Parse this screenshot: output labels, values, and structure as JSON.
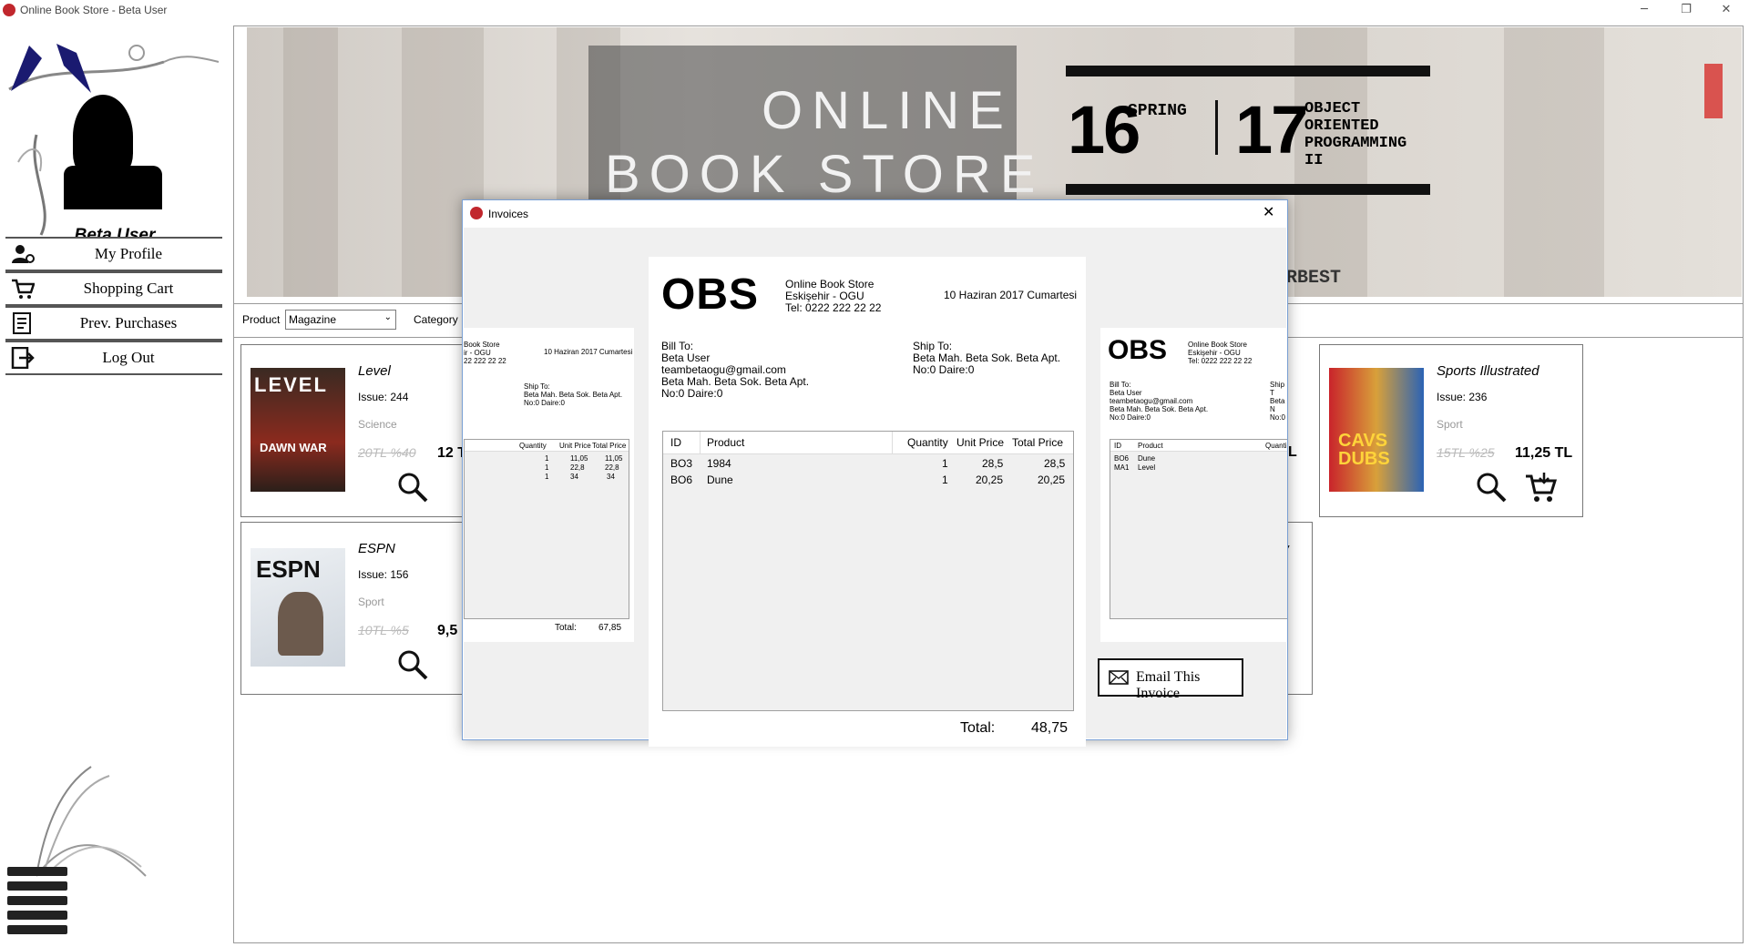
{
  "window": {
    "title": "Online Book Store - Beta User",
    "controls": {
      "minimize": "─",
      "maximize": "❐",
      "close": "✕"
    }
  },
  "sidebar": {
    "username": "Beta User",
    "items": [
      {
        "label": "My Profile",
        "icon": "user-gear-icon"
      },
      {
        "label": "Shopping Cart",
        "icon": "shopping-cart-icon"
      },
      {
        "label": "Prev. Purchases",
        "icon": "document-list-icon"
      },
      {
        "label": "Log Out",
        "icon": "logout-icon"
      }
    ]
  },
  "banner": {
    "line1": "ONLINE",
    "line2": "BOOK STORE",
    "num1": "16",
    "season": "SPRING",
    "num2": "17",
    "course": [
      "OBJECT",
      "ORIENTED",
      "PROGRAMMING",
      "II"
    ],
    "tail": "RBEST"
  },
  "filters": {
    "product_label": "Product",
    "product_value": "Magazine",
    "category_label": "Category"
  },
  "products": [
    {
      "title": "Level",
      "issue": "Issue: 244",
      "category": "Science",
      "old_price": "20TL  %40",
      "price": "12 T",
      "cover_text": "DAWN WAR"
    },
    {
      "title": "ESPN",
      "issue": "Issue: 156",
      "category": "Sport",
      "old_price": "10TL  %5",
      "price": "9,5",
      "cover_text": "ESPN"
    },
    {
      "title": "Sports Illustrated",
      "issue": "Issue: 236",
      "category": "Sport",
      "old_price": "15TL  %25",
      "price": "11,25 TL",
      "cover_text": "CAVS DUBS"
    }
  ],
  "partial_labels": {
    "card2_price_tail": "L",
    "card3_title_tail": "w"
  },
  "dialog": {
    "title": "Invoices",
    "close": "✕",
    "email_button": "Email This Invoice",
    "invoice": {
      "logo": "OBS",
      "store": [
        "Online Book Store",
        "Eskişehir - OGU",
        "Tel: 0222 222 22 22"
      ],
      "date": "10 Haziran 2017 Cumartesi",
      "bill_to_label": "Bill To:",
      "bill_to": [
        "Beta User",
        "teambetaogu@gmail.com",
        "Beta Mah. Beta Sok. Beta Apt.",
        "No:0 Daire:0"
      ],
      "ship_to_label": "Ship To:",
      "ship_to": [
        "Beta Mah. Beta Sok. Beta Apt.",
        "No:0 Daire:0"
      ],
      "columns": [
        "ID",
        "Product",
        "Quantity",
        "Unit Price",
        "Total Price"
      ],
      "rows": [
        {
          "id": "BO3",
          "product": "1984",
          "qty": "1",
          "unit": "28,5",
          "total": "28,5"
        },
        {
          "id": "BO6",
          "product": "Dune",
          "qty": "1",
          "unit": "20,25",
          "total": "20,25"
        }
      ],
      "total_label": "Total:",
      "total_value": "48,75"
    },
    "left_preview": {
      "store": [
        "Book Store",
        "ir - OGU",
        "22 222 22 22"
      ],
      "date": "10 Haziran 2017 Cumartesi",
      "ship_to_label": "Ship To:",
      "ship_to": [
        "Beta Mah. Beta Sok. Beta Apt.",
        "No:0 Daire:0"
      ],
      "columns": [
        "Quantity",
        "Unit Price",
        "Total Price"
      ],
      "rows": [
        {
          "qty": "1",
          "unit": "11,05",
          "total": "11,05"
        },
        {
          "qty": "1",
          "unit": "22,8",
          "total": "22,8"
        },
        {
          "qty": "1",
          "unit": "34",
          "total": "34"
        }
      ],
      "total_label": "Total:",
      "total_value": "67,85"
    },
    "right_preview": {
      "logo": "OBS",
      "store": [
        "Online Book Store",
        "Eskişehir - OGU",
        "Tel: 0222 222 22 22"
      ],
      "bill_to_label": "Bill To:",
      "bill_to": [
        "Beta User",
        "teambetaogu@gmail.com",
        "Beta Mah. Beta Sok. Beta Apt.",
        "No:0 Daire:0"
      ],
      "ship_to_label": "Ship T",
      "ship_to_tail": [
        "Beta N",
        "No:0"
      ],
      "columns": [
        "ID",
        "Product",
        "Quanti"
      ],
      "rows": [
        {
          "id": "BO6",
          "product": "Dune"
        },
        {
          "id": "MA1",
          "product": "Level"
        }
      ]
    }
  }
}
